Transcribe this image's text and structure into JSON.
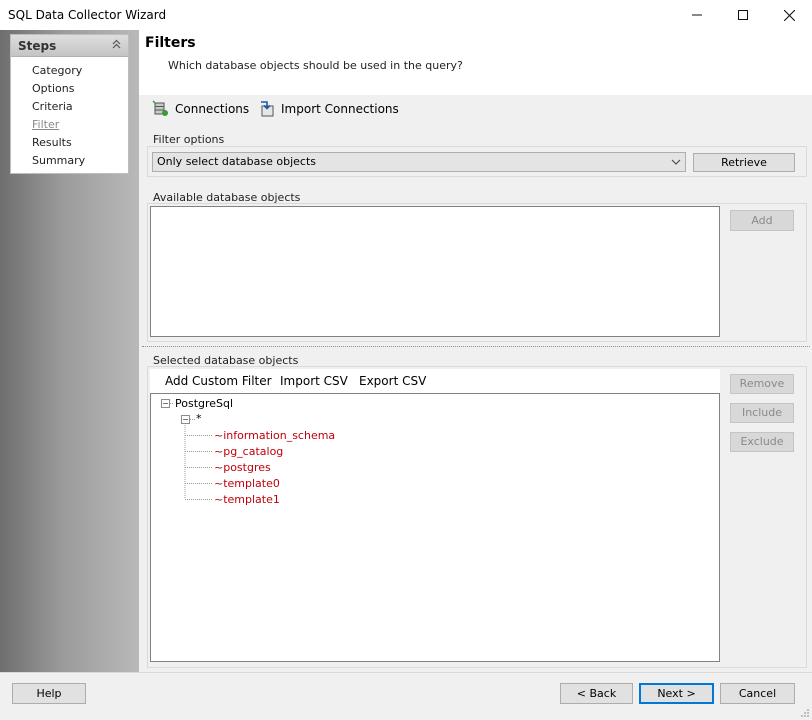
{
  "window": {
    "title": "SQL Data Collector Wizard"
  },
  "steps": {
    "header": "Steps",
    "items": [
      {
        "label": "Category"
      },
      {
        "label": "Options"
      },
      {
        "label": "Criteria"
      },
      {
        "label": "Filter"
      },
      {
        "label": "Results"
      },
      {
        "label": "Summary"
      }
    ],
    "current": "Filter"
  },
  "header": {
    "title": "Filters",
    "subtitle": "Which database objects should be used in the query?"
  },
  "toolbar": {
    "connections_label": "Connections",
    "import_connections_label": "Import Connections"
  },
  "filter_options": {
    "label": "Filter options",
    "selected": "Only select database objects",
    "retrieve_label": "Retrieve"
  },
  "available": {
    "label": "Available database objects",
    "add_label": "Add"
  },
  "selected": {
    "label": "Selected database objects",
    "add_custom_filter_label": "Add Custom Filter",
    "import_csv_label": "Import CSV",
    "export_csv_label": "Export CSV",
    "remove_label": "Remove",
    "include_label": "Include",
    "exclude_label": "Exclude",
    "tree": {
      "root": "PostgreSql",
      "child": "*",
      "leaves": [
        "~information_schema",
        "~pg_catalog",
        "~postgres",
        "~template0",
        "~template1"
      ]
    }
  },
  "footer": {
    "help_label": "Help",
    "back_label": "< Back",
    "next_label": "Next >",
    "cancel_label": "Cancel"
  },
  "colors": {
    "excluded_item": "#c0000b",
    "accent_focus": "#0078d7"
  }
}
